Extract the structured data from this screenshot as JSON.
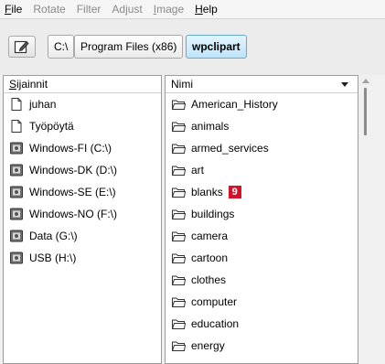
{
  "menubar": {
    "file": "ile",
    "file_mnemonic": "F",
    "rotate": "Rotate",
    "filter": "Filter",
    "adjust": "Adjust",
    "image": "mage",
    "image_mnemonic": "I",
    "help": "elp",
    "help_mnemonic": "H"
  },
  "breadcrumb": {
    "items": [
      "C:\\",
      "Program Files (x86)",
      "wpclipart"
    ]
  },
  "left_pane": {
    "header_mnemonic": "S",
    "header": "ijainnit",
    "items": [
      {
        "label": "juhan",
        "icon": "document-icon"
      },
      {
        "label": "Työpöytä",
        "icon": "document-icon"
      },
      {
        "label": "Windows-FI (C:\\)",
        "icon": "drive-icon"
      },
      {
        "label": "Windows-DK (D:\\)",
        "icon": "drive-icon"
      },
      {
        "label": "Windows-SE (E:\\)",
        "icon": "drive-icon"
      },
      {
        "label": "Windows-NO (F:\\)",
        "icon": "drive-icon"
      },
      {
        "label": "Data (G:\\)",
        "icon": "drive-icon"
      },
      {
        "label": "USB (H:\\)",
        "icon": "drive-icon"
      }
    ]
  },
  "right_pane": {
    "header": "Nimi",
    "badge": "9",
    "items": [
      "American_History",
      "animals",
      "armed_services",
      "art",
      "blanks",
      "buildings",
      "camera",
      "cartoon",
      "clothes",
      "computer",
      "education",
      "energy"
    ]
  },
  "colors": {
    "crumb_active": "#bde4fb",
    "badge": "#d4122a"
  }
}
